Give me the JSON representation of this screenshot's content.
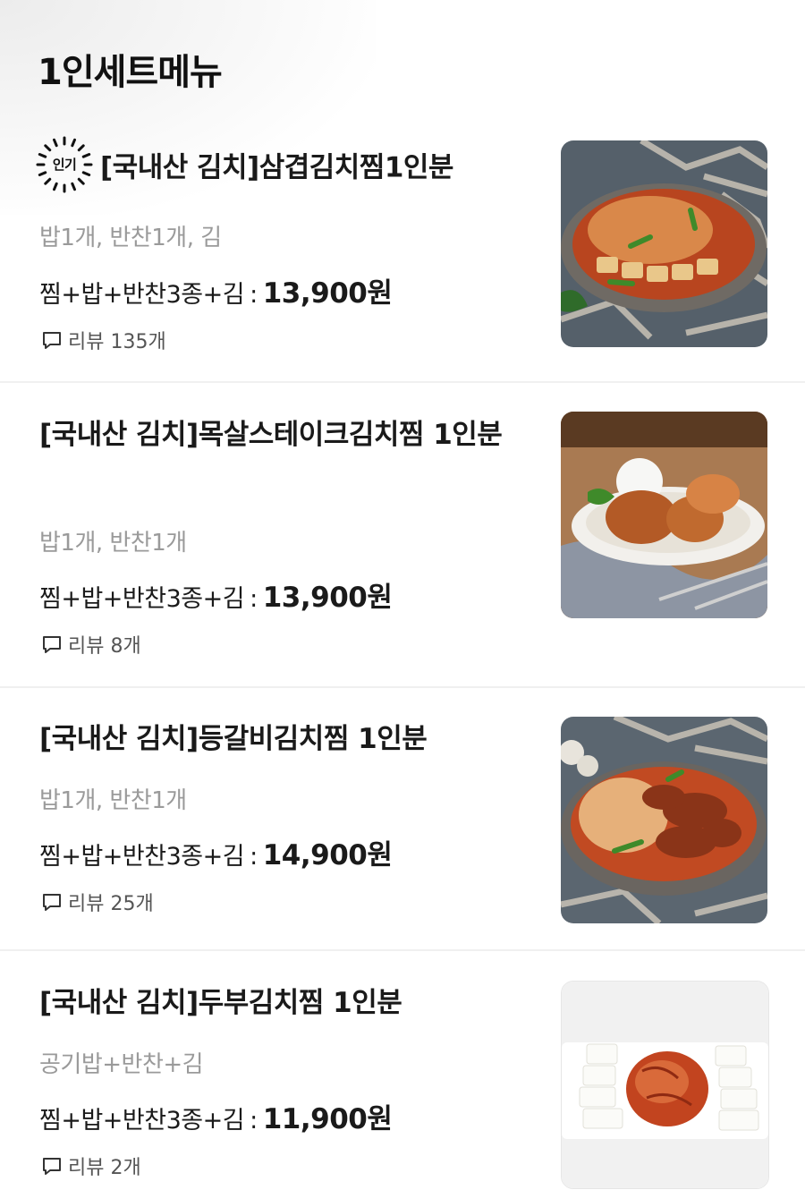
{
  "section": {
    "title": "1인세트메뉴"
  },
  "colors": {
    "text": "#1a1a1a",
    "sub": "#9a9a9a",
    "divider": "#f0f0f0"
  },
  "items": [
    {
      "badge": "인기",
      "name": "[국내산 김치]삼겹김치찜1인분",
      "desc": "밥1개, 반찬1개, 김",
      "set_label": "찜+밥+반찬3종+김",
      "separator": ":",
      "price": "13,900원",
      "review": "리뷰 135개",
      "image": "braised-kimchi-pork-belly-photo"
    },
    {
      "name": "[국내산 김치]목살스테이크김치찜 1인분",
      "desc": "밥1개, 반찬1개",
      "set_label": "찜+밥+반찬3종+김",
      "separator": ":",
      "price": "13,900원",
      "review": "리뷰 8개",
      "image": "pork-neck-steak-kimchi-plate-photo"
    },
    {
      "name": "[국내산 김치]등갈비김치찜 1인분",
      "desc": "밥1개, 반찬1개",
      "set_label": "찜+밥+반찬3종+김",
      "separator": ":",
      "price": "14,900원",
      "review": "리뷰 25개",
      "image": "pork-back-ribs-kimchi-photo"
    },
    {
      "name": "[국내산 김치]두부김치찜 1인분",
      "desc": "공기밥+반찬+김",
      "set_label": "찜+밥+반찬3종+김",
      "separator": ":",
      "price": "11,900원",
      "review": "리뷰 2개",
      "image": "tofu-kimchi-plate-photo"
    }
  ]
}
